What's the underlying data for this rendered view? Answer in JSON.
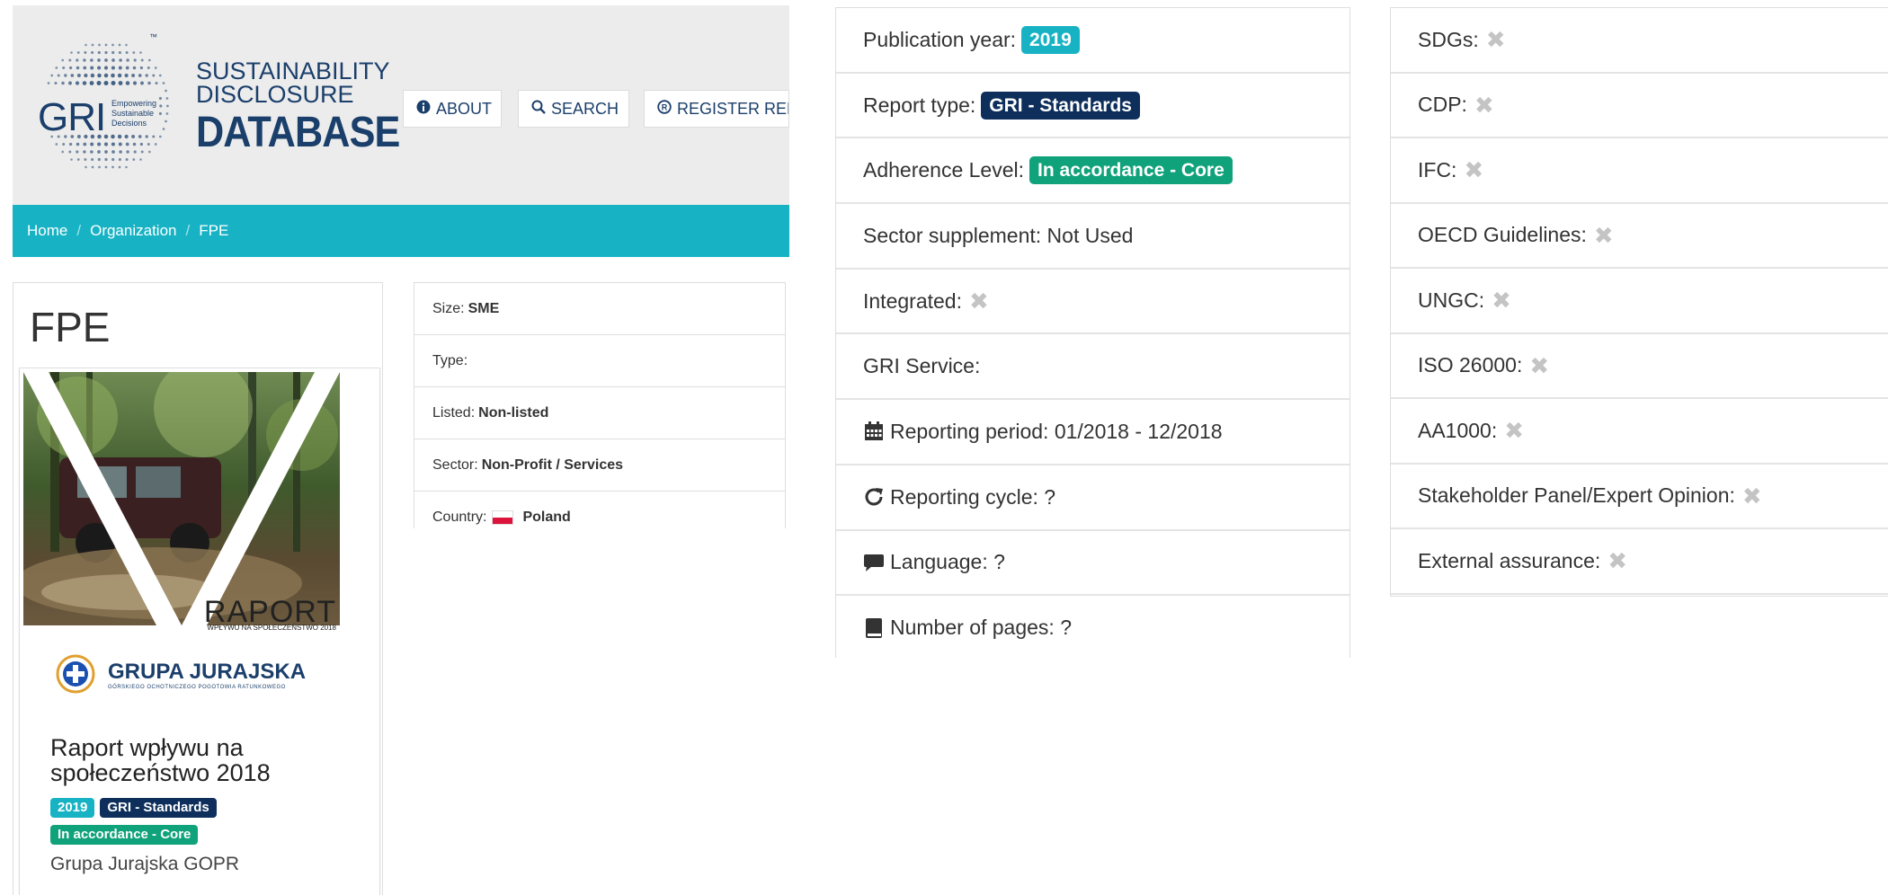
{
  "header": {
    "logo_text": "GRI",
    "logo_tagline": [
      "Empowering",
      "Sustainable",
      "Decisions"
    ],
    "trademark": "™",
    "title_line1": "SUSTAINABILITY",
    "title_line2": "DISCLOSURE",
    "title_line3": "DATABASE",
    "nav": {
      "about": "ABOUT",
      "search": "SEARCH",
      "register": "REGISTER REPORT"
    }
  },
  "breadcrumb": [
    "Home",
    "Organization",
    "FPE"
  ],
  "organization": {
    "name": "FPE",
    "details": {
      "size_label": "Size:",
      "size_value": "SME",
      "type_label": "Type:",
      "type_value": "",
      "listed_label": "Listed:",
      "listed_value": "Non-listed",
      "sector_label": "Sector:",
      "sector_value": "Non-Profit / Services",
      "country_label": "Country:",
      "country_value": "Poland"
    }
  },
  "report_card": {
    "cover_title": "RAPORT",
    "cover_subtitle": "WPŁYWU NA SPOŁECZEŃSTWO 2018",
    "cover_org": "GRUPA JURAJSKA",
    "cover_org_sub": "GÓRSKIEGO OCHOTNICZEGO POGOTOWIA RATUNKOWEGO",
    "title": "Raport wpływu na społeczeństwo 2018",
    "badges": {
      "year": "2019",
      "type": "GRI - Standards",
      "adherence": "In accordance - Core"
    },
    "organization": "Grupa Jurajska GOPR"
  },
  "report_info": {
    "publication_year_label": "Publication year:",
    "publication_year": "2019",
    "report_type_label": "Report type:",
    "report_type": "GRI - Standards",
    "adherence_label": "Adherence Level:",
    "adherence": "In accordance - Core",
    "sector_supplement": "Sector supplement: Not Used",
    "integrated_label": "Integrated:",
    "gri_service_label": "GRI Service:",
    "reporting_period": "Reporting period: 01/2018 - 12/2018",
    "reporting_cycle": "Reporting cycle: ?",
    "language": "Language: ?",
    "pages": "Number of pages: ?"
  },
  "frameworks": {
    "sdgs": "SDGs:",
    "cdp": "CDP:",
    "ifc": "IFC:",
    "oecd": "OECD Guidelines:",
    "ungc": "UNGC:",
    "iso": "ISO 26000:",
    "aa1000": "AA1000:",
    "stakeholder": "Stakeholder Panel/Expert Opinion:",
    "assurance": "External assurance:"
  },
  "colors": {
    "brand_navy": "#1b3f6b",
    "teal": "#17b3c4",
    "navy_badge": "#0e2f5b",
    "green_badge": "#10a27a",
    "x_mark": "#c4c4c4"
  },
  "icons": {
    "x_mark": "✖",
    "info": "info-circle-icon",
    "search": "search-icon",
    "register": "copyright-icon",
    "calendar": "calendar-icon",
    "cycle": "refresh-icon",
    "language": "comment-icon",
    "pages": "book-icon"
  }
}
